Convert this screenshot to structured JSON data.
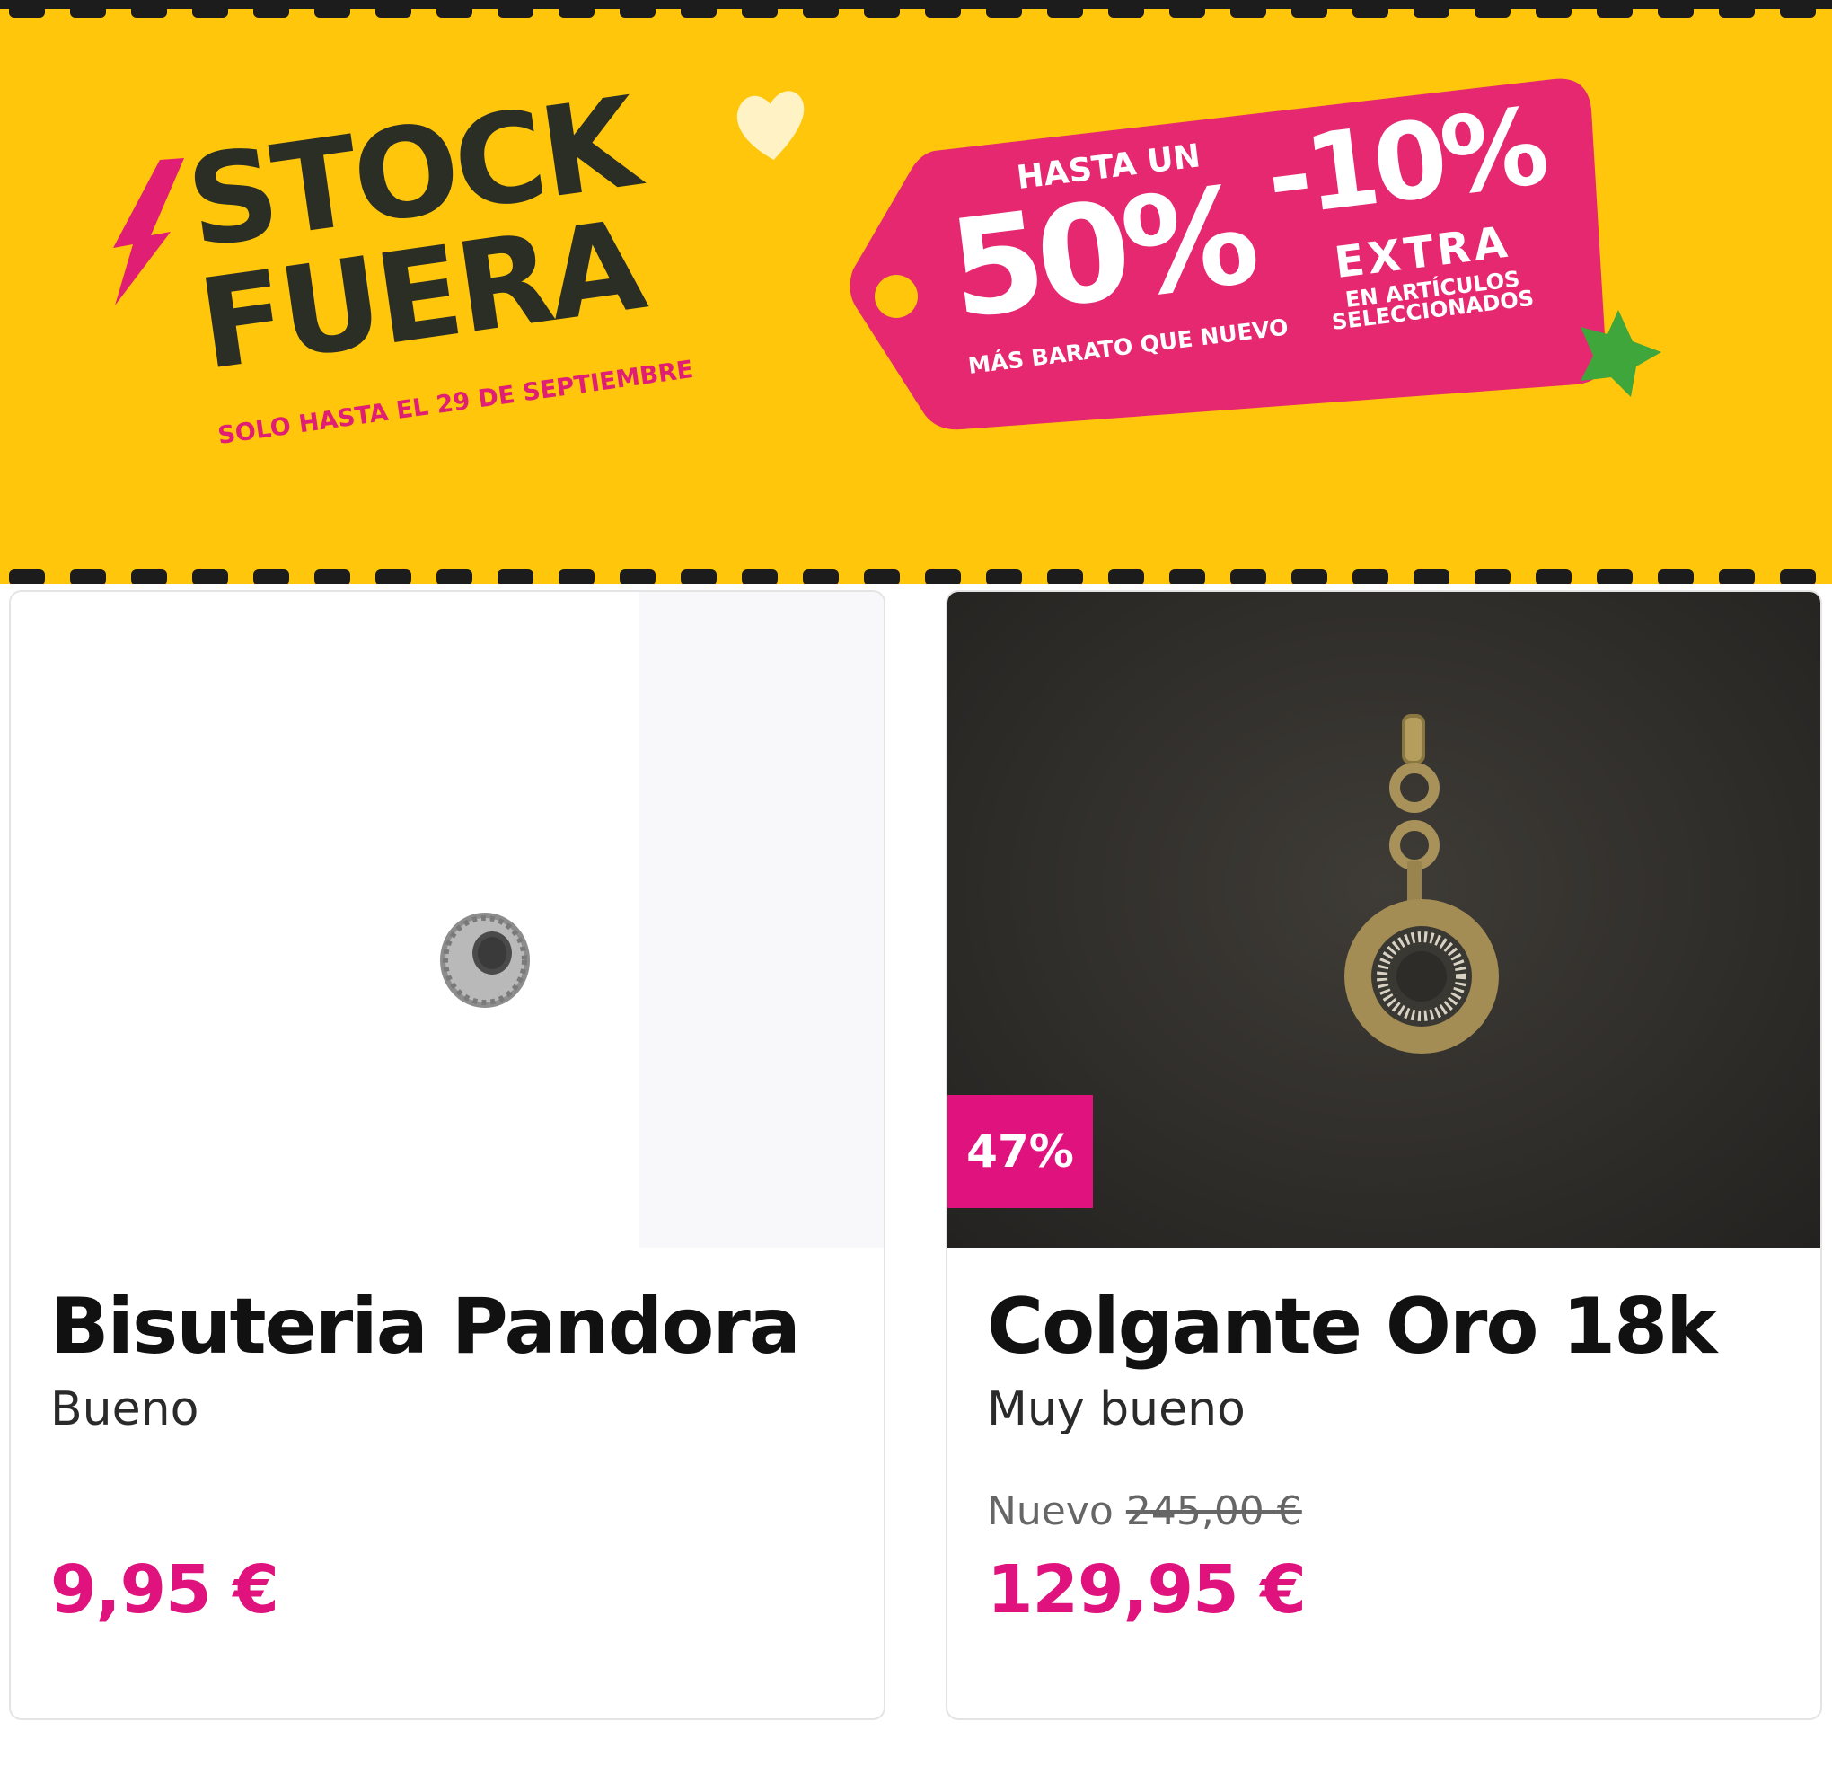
{
  "banner": {
    "title_line1": "STOCK",
    "title_line2": "FUERA",
    "subtitle": "SOLO HASTA EL 29 DE SEPTIEMBRE",
    "tag": {
      "hasta_un": "HASTA UN",
      "big_percent": "50%",
      "mas_barato": "MÁS BARATO QUE NUEVO",
      "extra_percent": "-10%",
      "extra": "EXTRA",
      "en_articulos": "EN ARTÍCULOS",
      "seleccionados": "SELECCIONADOS"
    },
    "colors": {
      "background": "#ffc60b",
      "tag": "#e5286f",
      "title": "#2a2e24",
      "accent": "#e01e73",
      "star": "#3ea63a"
    }
  },
  "products": [
    {
      "title": "Bisuteria Pandora",
      "condition": "Bueno",
      "price": "9,95 €"
    },
    {
      "title": "Colgante Oro 18k",
      "condition": "Muy bueno",
      "ref_label": "Nuevo",
      "ref_price": "245,00 €",
      "price": "129,95 €",
      "discount": "47%"
    }
  ]
}
